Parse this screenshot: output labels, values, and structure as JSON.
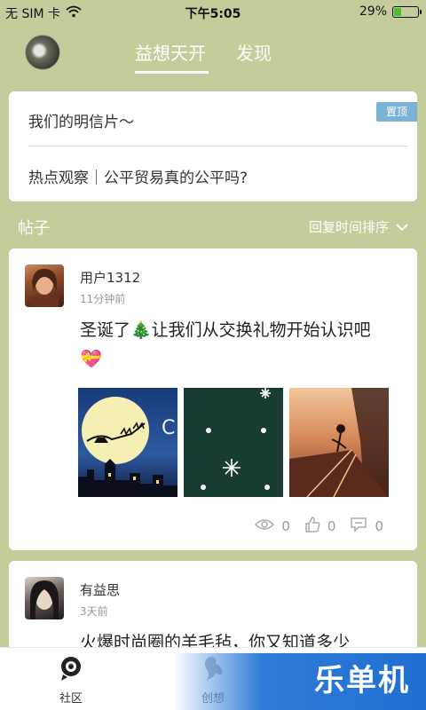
{
  "status_bar": {
    "carrier": "无 SIM 卡",
    "time": "下午5:05",
    "battery_pct": "29%",
    "battery_level": 0.29
  },
  "top_nav": {
    "tabs": [
      {
        "label": "益想天开",
        "active": true
      },
      {
        "label": "发现",
        "active": false
      }
    ]
  },
  "pinned": {
    "badge": "置顶",
    "items": [
      {
        "text": "我们的明信片～"
      },
      {
        "text": "热点观察｜公平贸易真的公平吗?"
      }
    ]
  },
  "posts_section": {
    "title": "帖子",
    "sort_label": "回复时间排序"
  },
  "posts": [
    {
      "user": "用户1312",
      "time": "11分钟前",
      "title": "圣诞了🎄让我们从交换礼物开始认识吧",
      "title_extra": "💝",
      "stats": {
        "views": "0",
        "likes": "0",
        "comments": "0"
      }
    },
    {
      "user": "有益思",
      "time": "3天前",
      "title": "火爆时尚圈的羊毛毡，你又知道多少"
    }
  ],
  "bottom_bar": {
    "tabs": [
      {
        "label": "社区",
        "icon": "community-icon"
      },
      {
        "label": "创想",
        "icon": "idea-icon"
      }
    ]
  },
  "watermark": {
    "text": "乐单机"
  },
  "colors": {
    "background": "#c5cc9c",
    "pin_badge": "#7bb3d6",
    "battery_fill": "#4ac02a",
    "watermark_blue": "#1f6ed1"
  }
}
